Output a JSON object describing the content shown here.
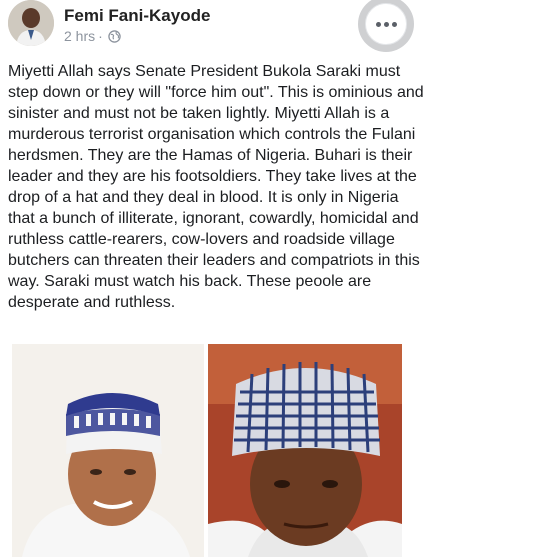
{
  "post": {
    "author": "Femi Fani-Kayode",
    "timestamp": "2 hrs",
    "separator": "·",
    "privacy_icon": "globe-icon",
    "more_icon": "more-options-icon",
    "text": "Miyetti Allah says Senate President Bukola Saraki must step down or they will \"force him out\". This is ominious and sinister and must not be taken lightly. Miyetti Allah is a murderous terrorist organisation which controls the Fulani herdsmen. They are the Hamas of Nigeria. Buhari is their leader and they are his footsoldiers. They take lives at the drop of a hat and they deal in blood. It is only in Nigeria that a bunch of illiterate, ignorant, cowardly, homicidal and ruthless cattle-rearers, cow-lovers and roadside village butchers can threaten their leaders and compatriots in this way. Saraki must watch his back. These peoole are desperate and ruthless."
  },
  "colors": {
    "author": "#222222",
    "meta": "#8d949e",
    "text": "#1c1e21",
    "more_button_bg": "#cfd0d2"
  }
}
